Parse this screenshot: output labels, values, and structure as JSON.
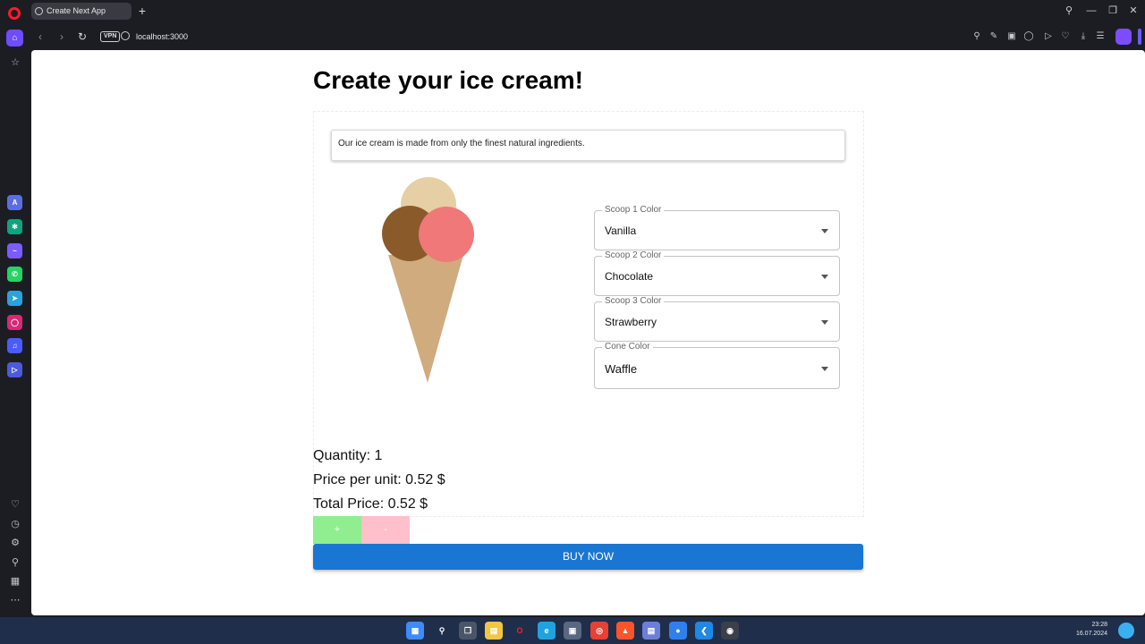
{
  "browser": {
    "tab_title": "Create Next App",
    "new_tab_label": "+",
    "url": "localhost:3000",
    "vpn_label": "VPN"
  },
  "page": {
    "title": "Create your ice cream!",
    "info_text": "Our ice cream is made from only the finest natural ingredients.",
    "selects": [
      {
        "label": "Scoop 1 Color",
        "value": "Vanilla"
      },
      {
        "label": "Scoop 2 Color",
        "value": "Chocolate"
      },
      {
        "label": "Scoop 3 Color",
        "value": "Strawberry"
      },
      {
        "label": "Cone Color",
        "value": "Waffle"
      }
    ],
    "quantity_text": "Quantity: 1",
    "price_per_unit_text": "Price per unit: 0.52 $",
    "total_price_text": "Total Price: 0.52 $",
    "plus_label": "+",
    "minus_label": "-",
    "buy_label": "BUY NOW",
    "colors": {
      "vanilla": "#e6cfa4",
      "chocolate": "#8b5a2b",
      "strawberry": "#f07878",
      "waffle": "#d0ab7e",
      "plus_bg": "#90ee90",
      "minus_bg": "#ffc0cb",
      "buy_bg": "#1976d2"
    }
  },
  "taskbar": {
    "time": "23:28",
    "date": "16.07.2024"
  }
}
